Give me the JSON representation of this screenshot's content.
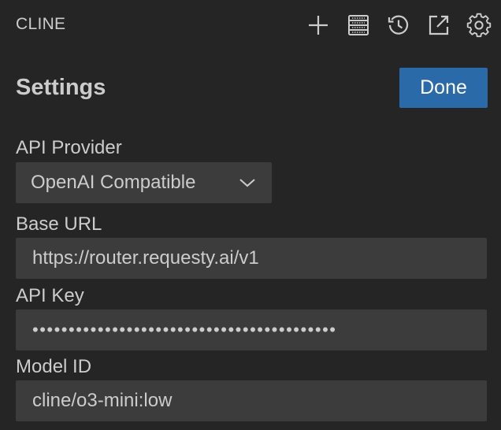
{
  "header": {
    "title": "CLINE",
    "icons": [
      "plus-icon",
      "mcp-servers-icon",
      "history-icon",
      "popout-icon",
      "gear-icon"
    ]
  },
  "settings": {
    "title": "Settings",
    "done_label": "Done"
  },
  "api_provider": {
    "label": "API Provider",
    "selected": "OpenAI Compatible"
  },
  "base_url": {
    "label": "Base URL",
    "value": "https://router.requesty.ai/v1"
  },
  "api_key": {
    "label": "API Key",
    "value": "••••••••••••••••••••••••••••••••••••••••••"
  },
  "model_id": {
    "label": "Model ID",
    "value": "cline/o3-mini:low"
  },
  "colors": {
    "background": "#252526",
    "input_background": "#3c3c3c",
    "button_primary": "#2b6aa8",
    "text": "#cccccc"
  }
}
